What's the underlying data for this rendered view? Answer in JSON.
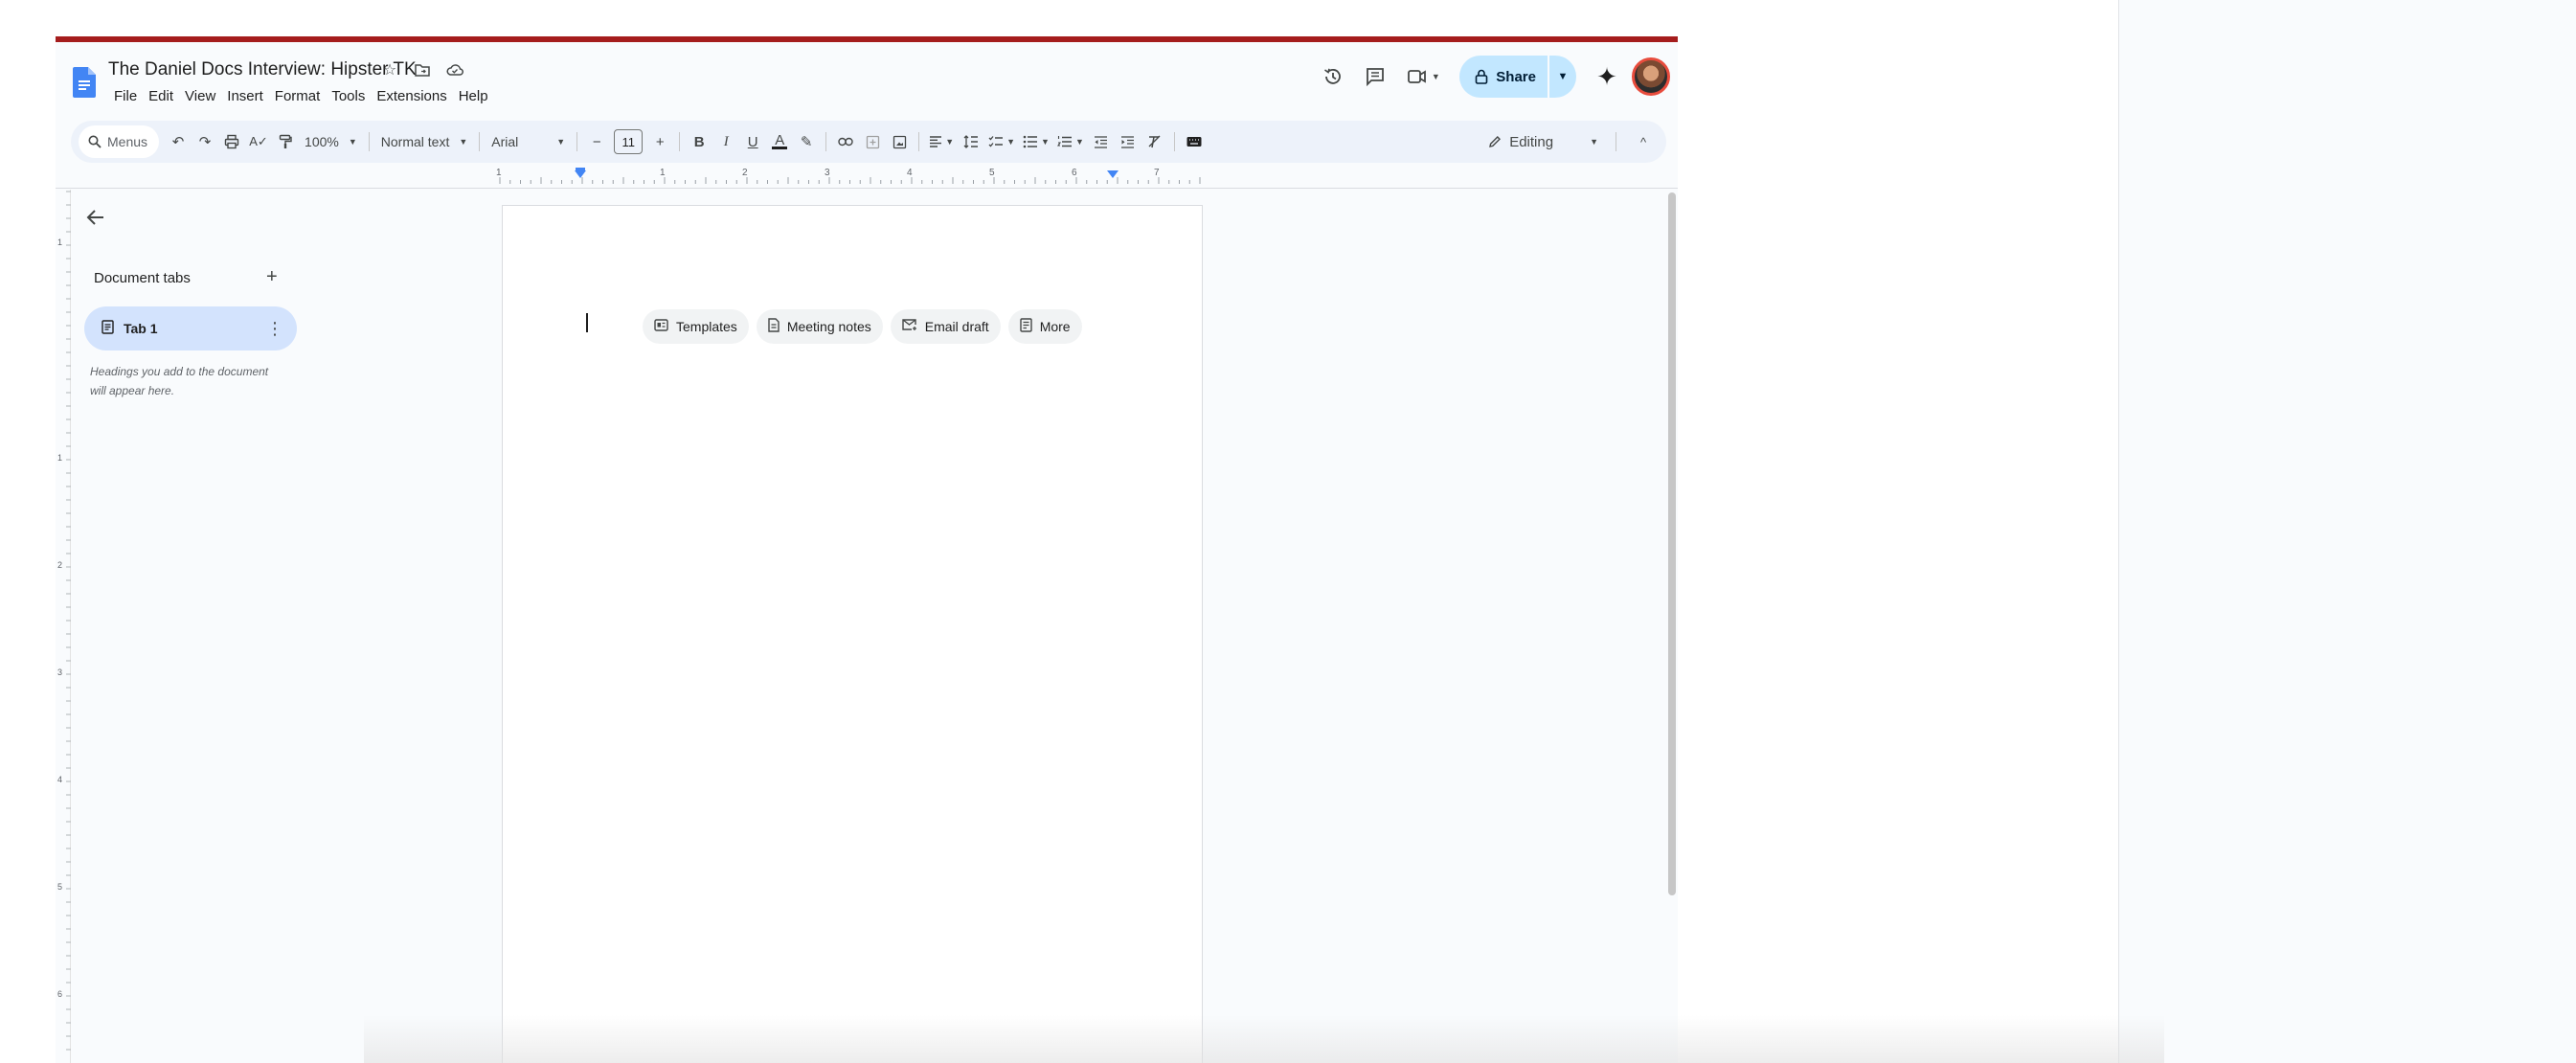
{
  "doc": {
    "title": "The Daniel Docs Interview: Hipster TK"
  },
  "menu": [
    "File",
    "Edit",
    "View",
    "Insert",
    "Format",
    "Tools",
    "Extensions",
    "Help"
  ],
  "header_right": {
    "share_label": "Share"
  },
  "toolbar": {
    "search_placeholder": "Menus",
    "zoom": "100%",
    "style": "Normal text",
    "font": "Arial",
    "font_size": "11",
    "mode": "Editing"
  },
  "ruler": {
    "h_labels": [
      "1",
      "1",
      "2",
      "3",
      "4",
      "5",
      "6",
      "7"
    ],
    "v_labels": [
      "1",
      "1",
      "2",
      "3",
      "4",
      "5",
      "6"
    ]
  },
  "sidebar": {
    "section_title": "Document tabs",
    "tabs": [
      {
        "label": "Tab 1"
      }
    ],
    "hint": "Headings you add to the document will appear here."
  },
  "chips": [
    {
      "label": "Templates",
      "icon": "templates-icon"
    },
    {
      "label": "Meeting notes",
      "icon": "doc-icon"
    },
    {
      "label": "Email draft",
      "icon": "email-icon"
    },
    {
      "label": "More",
      "icon": "more-doc-icon"
    }
  ],
  "colors": {
    "accent_top_line": "#a51d1d",
    "share_bg": "#c2e7ff",
    "active_tab_bg": "#d3e3fd",
    "toolbar_bg": "#edf2fa"
  }
}
